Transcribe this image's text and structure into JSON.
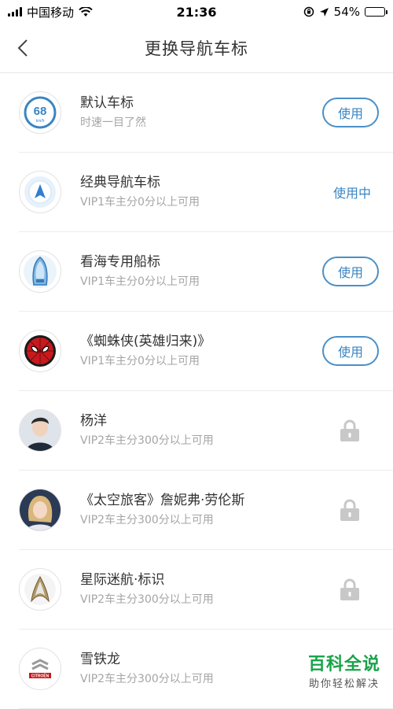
{
  "status": {
    "carrier": "中国移动",
    "time": "21:36",
    "battery_text": "54%",
    "battery_level": 0.54
  },
  "nav": {
    "title": "更换导航车标"
  },
  "items": [
    {
      "title": "默认车标",
      "subtitle": "时速一目了然",
      "action": "使用",
      "icon": "speed-68-icon",
      "speed": "68",
      "unit": "km/h"
    },
    {
      "title": "经典导航车标",
      "subtitle": "VIP1车主分0分以上可用",
      "action": "使用中",
      "icon": "navigation-arrow-icon"
    },
    {
      "title": "看海专用船标",
      "subtitle": "VIP1车主分0分以上可用",
      "action": "使用",
      "icon": "boat-icon"
    },
    {
      "title": "《蜘蛛侠(英雄归来)》",
      "subtitle": "VIP1车主分0分以上可用",
      "action": "使用",
      "icon": "spiderman-icon"
    },
    {
      "title": "杨洋",
      "subtitle": "VIP2车主分300分以上可用",
      "action": "locked",
      "icon": "person-portrait-icon"
    },
    {
      "title": "《太空旅客》詹妮弗·劳伦斯",
      "subtitle": "VIP2车主分300分以上可用",
      "action": "locked",
      "icon": "woman-portrait-icon"
    },
    {
      "title": "星际迷航·标识",
      "subtitle": "VIP2车主分300分以上可用",
      "action": "locked",
      "icon": "star-trek-badge-icon"
    },
    {
      "title": "雪铁龙",
      "subtitle": "VIP2车主分300分以上可用",
      "action": "locked",
      "icon": "citroen-logo-icon",
      "logo_text": "CITROËN"
    }
  ],
  "watermark": {
    "main": "百科全说",
    "sub": "助你轻松解决"
  },
  "colors": {
    "accent": "#3a85c2",
    "lock": "#c8c8c8",
    "watermark_green": "#1aa34a"
  }
}
